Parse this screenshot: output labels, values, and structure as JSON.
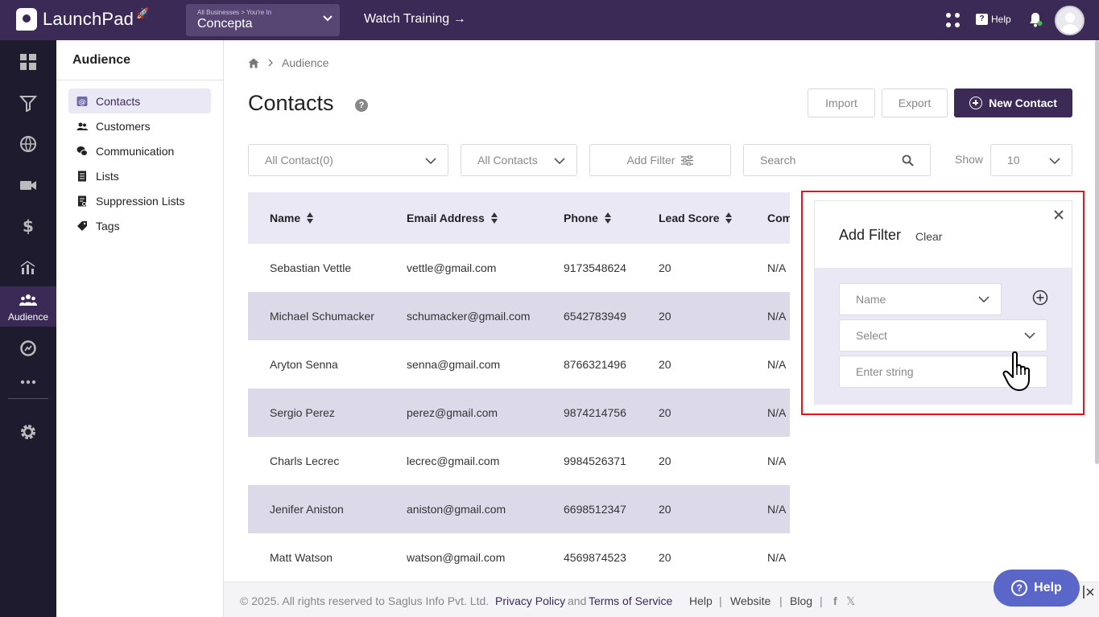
{
  "app": {
    "name": "LaunchPad",
    "business_crumb": "All Businesses > You're In",
    "business_name": "Concepta",
    "watch_training": "Watch Training →",
    "help": "Help"
  },
  "rail": {
    "active_label": "Audience"
  },
  "subnav": {
    "title": "Audience",
    "items": [
      {
        "label": "Contacts",
        "icon": "contact-card-icon"
      },
      {
        "label": "Customers",
        "icon": "users-icon"
      },
      {
        "label": "Communication",
        "icon": "chat-icon"
      },
      {
        "label": "Lists",
        "icon": "list-doc-icon"
      },
      {
        "label": "Suppression Lists",
        "icon": "suppression-doc-icon"
      },
      {
        "label": "Tags",
        "icon": "tag-icon"
      }
    ]
  },
  "breadcrumb": {
    "current": "Audience"
  },
  "page": {
    "title": "Contacts",
    "help_glyph": "?",
    "import": "Import",
    "export": "Export",
    "new_contact": "New Contact"
  },
  "filters": {
    "contact_select": "All Contact(0)",
    "contacts_type": "All Contacts",
    "add_filter": "Add Filter",
    "search_placeholder": "Search",
    "show_label": "Show",
    "show_value": "10"
  },
  "table": {
    "columns": [
      "Name",
      "Email Address",
      "Phone",
      "Lead Score",
      "Com"
    ],
    "rows": [
      {
        "name": "Sebastian Vettle",
        "email": "vettle@gmail.com",
        "phone": "9173548624",
        "score": "20",
        "com": "N/A"
      },
      {
        "name": "Michael Schumacker",
        "email": "schumacker@gmail.com",
        "phone": "6542783949",
        "score": "20",
        "com": "N/A"
      },
      {
        "name": "Aryton Senna",
        "email": "senna@gmail.com",
        "phone": "8766321496",
        "score": "20",
        "com": "N/A"
      },
      {
        "name": "Sergio Perez",
        "email": "perez@gmail.com",
        "phone": "9874214756",
        "score": "20",
        "com": "N/A"
      },
      {
        "name": "Charls Lecrec",
        "email": "lecrec@gmail.com",
        "phone": "9984526371",
        "score": "20",
        "com": "N/A"
      },
      {
        "name": "Jenifer Aniston",
        "email": "aniston@gmail.com",
        "phone": "6698512347",
        "score": "20",
        "com": "N/A"
      },
      {
        "name": "Matt Watson",
        "email": "watson@gmail.com",
        "phone": "4569874523",
        "score": "20",
        "com": "N/A"
      }
    ]
  },
  "filter_panel": {
    "title": "Add Filter",
    "clear": "Clear",
    "field_select": "Name",
    "operator_select": "Select",
    "value_placeholder": "Enter string"
  },
  "footer": {
    "copyright": "©  2025. All rights reserved to Saglus Info Pvt. Ltd.",
    "privacy": "Privacy Policy",
    "and": "and",
    "terms": "Terms of Service",
    "help": "Help",
    "sep": "|",
    "website": "Website",
    "blog": "Blog",
    "social_f": "f",
    "social_x": "𝕏"
  },
  "floating_help": "Help",
  "colors": {
    "brand": "#3b2a55",
    "rail": "#1f1b2e",
    "row_alt": "#dcdae9",
    "highlight": "#e0151c",
    "help_button": "#5a67c8"
  }
}
